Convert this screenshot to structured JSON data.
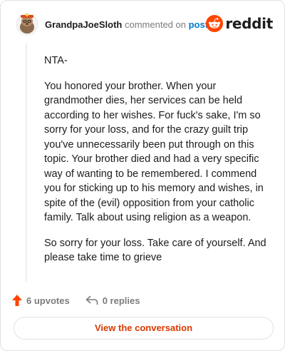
{
  "header": {
    "username": "GrandpaJoeSloth",
    "action_text": "commented on",
    "post_link": "post",
    "brand": "reddit"
  },
  "comment": {
    "paragraphs": [
      "NTA-",
      "You honored your brother. When your grandmother dies, her services can be held according to her wishes. For fuck's sake, I'm so sorry for your loss, and for the crazy guilt trip you've unnecessarily been put through on this topic. Your brother died and had a very specific way of wanting to be remembered. I commend you for sticking up to his memory and wishes, in spite of the (evil) opposition from your catholic family. Talk about using religion as a weapon.",
      "So sorry for your loss. Take care of yourself. And please take time to grieve"
    ]
  },
  "footer": {
    "upvotes": "6 upvotes",
    "replies": "0 replies",
    "cta": "View the conversation"
  },
  "colors": {
    "accent": "#ff4500",
    "link": "#0079d3",
    "cta_text": "#d93a00"
  },
  "icons": {
    "avatar": "sloth-avatar",
    "brand": "reddit-snoo-icon",
    "upvote": "upvote-arrow-icon",
    "reply": "reply-arrow-icon"
  }
}
